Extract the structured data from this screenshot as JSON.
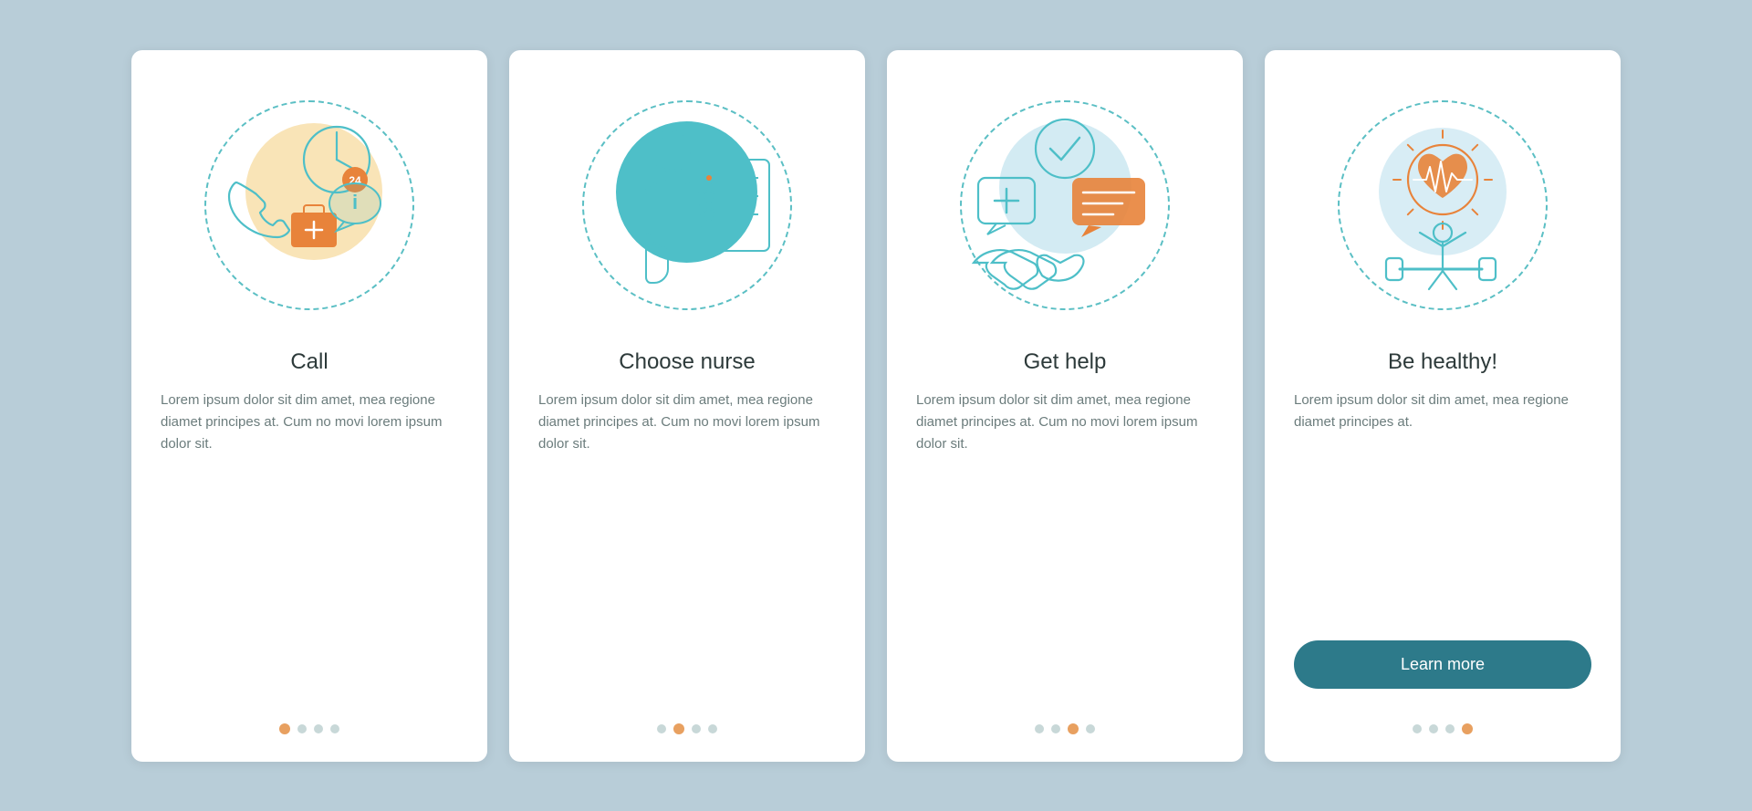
{
  "cards": [
    {
      "id": "card-call",
      "title": "Call",
      "text": "Lorem ipsum dolor sit dim amet, mea regione diamet principes at. Cum no movi lorem ipsum dolor sit.",
      "active_dot": 1,
      "dot_count": 4,
      "show_button": false,
      "button_label": ""
    },
    {
      "id": "card-choose-nurse",
      "title": "Choose nurse",
      "text": "Lorem ipsum dolor sit dim amet, mea regione diamet principes at. Cum no movi lorem ipsum dolor sit.",
      "active_dot": 2,
      "dot_count": 4,
      "show_button": false,
      "button_label": ""
    },
    {
      "id": "card-get-help",
      "title": "Get help",
      "text": "Lorem ipsum dolor sit dim amet, mea regione diamet principes at. Cum no movi lorem ipsum dolor sit.",
      "active_dot": 3,
      "dot_count": 4,
      "show_button": false,
      "button_label": ""
    },
    {
      "id": "card-be-healthy",
      "title": "Be healthy!",
      "text": "Lorem ipsum dolor sit dim amet, mea regione diamet principes at.",
      "active_dot": 4,
      "dot_count": 4,
      "show_button": true,
      "button_label": "Learn more"
    }
  ],
  "accent_color": "#e8833a",
  "teal_color": "#4ebfc8",
  "text_color": "#5a6b6b",
  "bg_color": "#b8cdd8"
}
